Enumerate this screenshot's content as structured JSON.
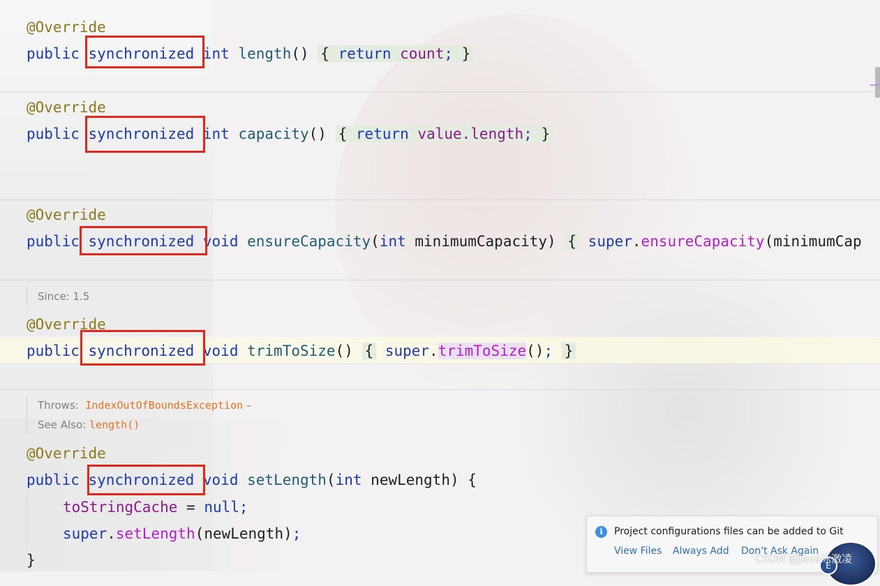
{
  "methods": [
    {
      "annotation": "@Override",
      "kw_public": "public",
      "kw_sync": "synchronized",
      "ret": "int",
      "name": "length",
      "params": "()",
      "body_open": "{",
      "kw_return": "return",
      "field": "count",
      "tail": ";",
      "body_close": "}"
    },
    {
      "annotation": "@Override",
      "kw_public": "public",
      "kw_sync": "synchronized",
      "ret": "int",
      "name": "capacity",
      "params": "()",
      "body_open": "{",
      "kw_return": "return",
      "field": "value",
      "field_member": ".length",
      "tail": ";",
      "body_close": "}"
    },
    {
      "annotation": "@Override",
      "kw_public": "public",
      "kw_sync": "synchronized",
      "ret": "void",
      "name": "ensureCapacity",
      "params_open": "(",
      "param_type": "int",
      "param_name": "minimumCapacity",
      "params_close": ")",
      "body_open": "{",
      "kw_super": "super",
      "dot": ".",
      "call": "ensureCapacity",
      "call_args": "(minimumCap"
    },
    {
      "doc_since_label": "Since: 1.5",
      "annotation": "@Override",
      "kw_public": "public",
      "kw_sync": "synchronized",
      "ret": "void",
      "name": "trimToSize",
      "params": "()",
      "body_open": "{",
      "kw_super": "super",
      "dot": ".",
      "call": "trimToSize",
      "call_parens": "()",
      "tail": ";",
      "body_close": "}"
    },
    {
      "doc_throws_label": "Throws:",
      "doc_throws_value": "IndexOutOfBoundsException",
      "doc_throws_dash": "–",
      "doc_see_label": "See Also:",
      "doc_see_value": "length()",
      "annotation": "@Override",
      "kw_public": "public",
      "kw_sync": "synchronized",
      "ret": "void",
      "name": "setLength",
      "params_open": "(",
      "param_type": "int",
      "param_name": "newLength",
      "params_close": ")",
      "body_open": "{",
      "line2_field": "toStringCache",
      "line2_op": " = ",
      "line2_kw": "null",
      "line2_tail": ";",
      "line3_kw": "super",
      "line3_dot": ".",
      "line3_call": "setLength",
      "line3_args": "(newLength)",
      "line3_tail": ";",
      "close": "}"
    }
  ],
  "notification": {
    "message": "Project configurations files can be added to Git",
    "action_view": "View Files",
    "action_always": "Always Add",
    "action_dont": "Don't Ask Again"
  },
  "watermark": "CSDN @Java冰激凌",
  "avatar_badge": "E",
  "colors": {
    "keyword": "#1a3bb0",
    "annotation": "#8a7a1a",
    "method": "#1d5f73",
    "field": "#8a1a8a",
    "call": "#b51fcc",
    "highlight_box": "#e5261b",
    "doc_link": "#e8731e"
  }
}
